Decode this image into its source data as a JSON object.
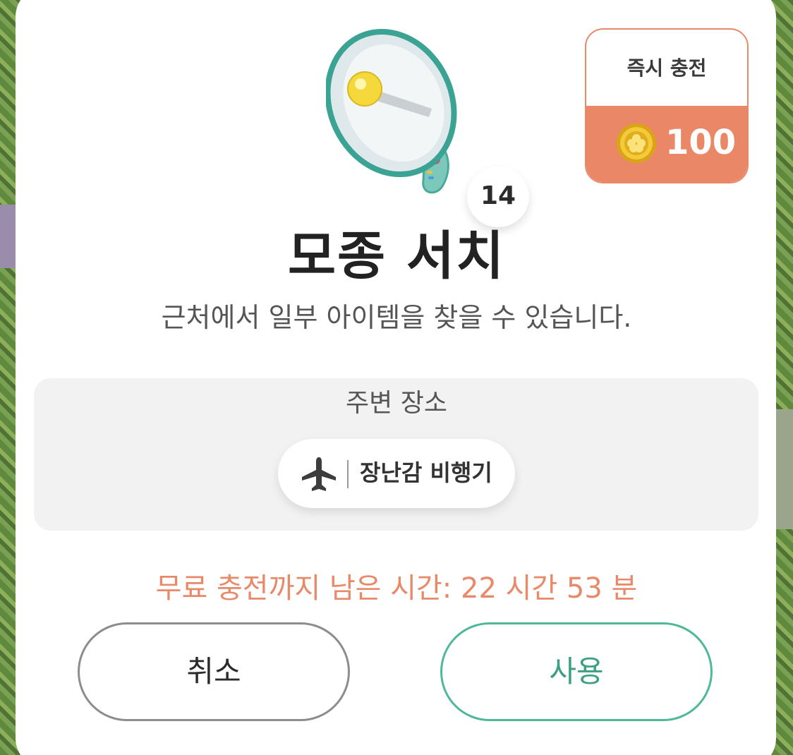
{
  "dialog": {
    "title": "모종 서치",
    "description": "근처에서 일부 아이템을 찾을 수 있습니다.",
    "item_count": "14"
  },
  "instant_charge": {
    "label": "즉시 충전",
    "price": "100",
    "currency_icon": "coin-icon"
  },
  "nearby": {
    "title": "주변 장소",
    "place_label": "장난감 비행기",
    "place_icon": "airplane-icon"
  },
  "timer": {
    "text": "무료 충전까지 남은 시간: 22 시간 53 분"
  },
  "buttons": {
    "cancel_label": "취소",
    "use_label": "사용"
  },
  "colors": {
    "accent_orange": "#ea8767",
    "accent_green": "#4fb89a",
    "neutral_border": "#8d8d8d"
  }
}
